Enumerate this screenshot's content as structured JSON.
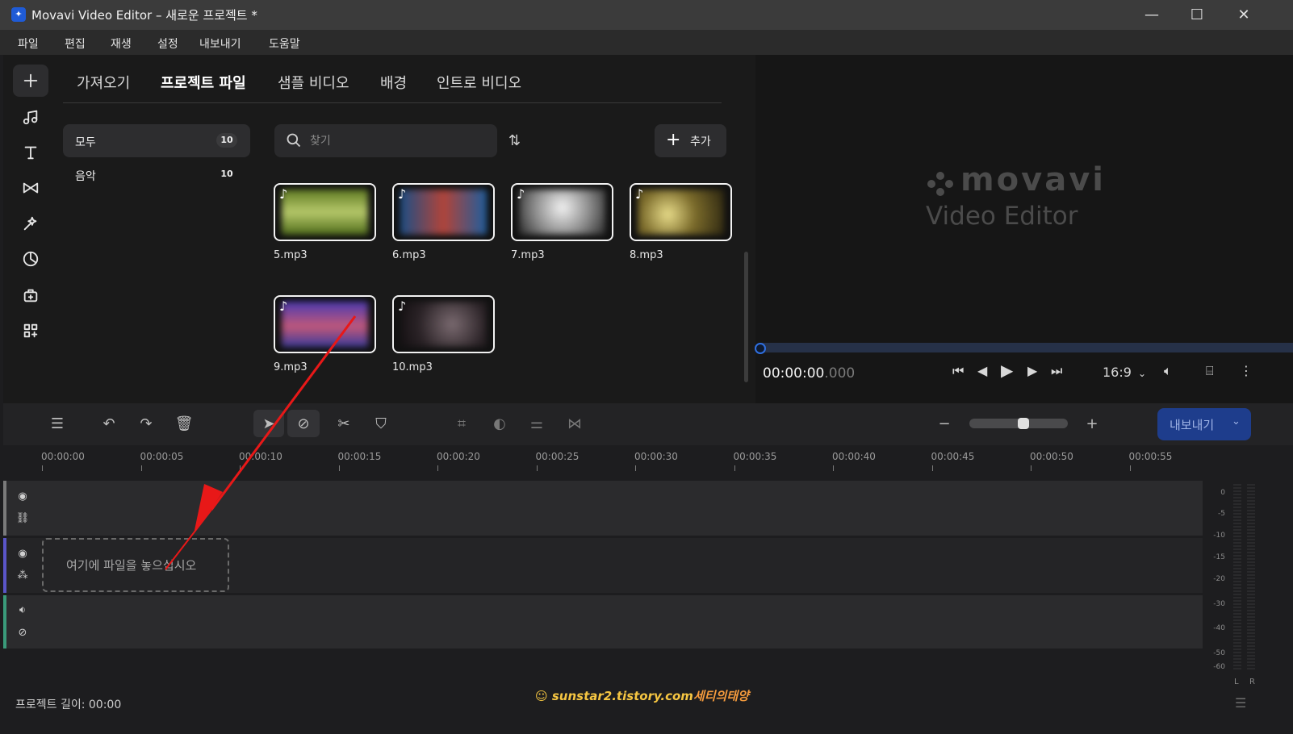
{
  "window": {
    "title": "Movavi Video Editor – 새로운 프로젝트 *",
    "app_icon": "movavi-app-icon",
    "controls": [
      "minimize-icon",
      "maximize-icon",
      "close-icon"
    ]
  },
  "menu": [
    "파일",
    "편집",
    "재생",
    "설정",
    "내보내기",
    "도움말"
  ],
  "sidebar_icons": [
    "plus-icon",
    "music-note-icon",
    "text-icon",
    "transition-icon",
    "effects-icon",
    "clock-icon",
    "stickers-icon",
    "more-tools-icon"
  ],
  "import": {
    "tabs": [
      "가져오기",
      "프로젝트 파일",
      "샘플 비디오",
      "배경",
      "인트로 비디오"
    ],
    "active_tab": "프로젝트 파일",
    "categories": [
      {
        "label": "모두",
        "count": "10"
      },
      {
        "label": "음악",
        "count": "10"
      }
    ],
    "search": {
      "placeholder": "찾기",
      "value": ""
    },
    "sort_icon": "sort-icon",
    "add_label": "추가",
    "files": [
      {
        "name": "5.mp3",
        "color": "#7e9a3a"
      },
      {
        "name": "6.mp3",
        "color": "#2c5f8f"
      },
      {
        "name": "7.mp3",
        "color": "#a9a9a9"
      },
      {
        "name": "8.mp3",
        "color": "#8a7a3a"
      },
      {
        "name": "9.mp3",
        "color": "#6a4aa8"
      },
      {
        "name": "10.mp3",
        "color": "#3a3238"
      }
    ]
  },
  "preview": {
    "logo_top": "movavi",
    "logo_bottom": "Video Editor",
    "timecode_main": "00:00:00",
    "timecode_ms": ".000",
    "aspect": "16:9",
    "accent": "#2f6fe0"
  },
  "timeline": {
    "export_label": "내보내기",
    "zoom_level": 0.55,
    "ruler": [
      "00:00:00",
      "00:00:05",
      "00:00:10",
      "00:00:15",
      "00:00:20",
      "00:00:25",
      "00:00:30",
      "00:00:35",
      "00:00:40",
      "00:00:45",
      "00:00:50",
      "00:00:55"
    ],
    "drop_text": "여기에 파일을 놓으십시오",
    "track_colors": [
      "#7a7a7a",
      "#5a55c8",
      "#3a9a7a"
    ]
  },
  "meter": {
    "db_labels": [
      "0",
      "-5",
      "-10",
      "-15",
      "-20",
      "-30",
      "-40",
      "-50",
      "-60"
    ],
    "channels": [
      "L",
      "R"
    ]
  },
  "status": {
    "project_length": "프로젝트 길이: 00:00"
  },
  "watermark": {
    "site": "sunstar2.tistory.com",
    "name": "세티의태양"
  }
}
